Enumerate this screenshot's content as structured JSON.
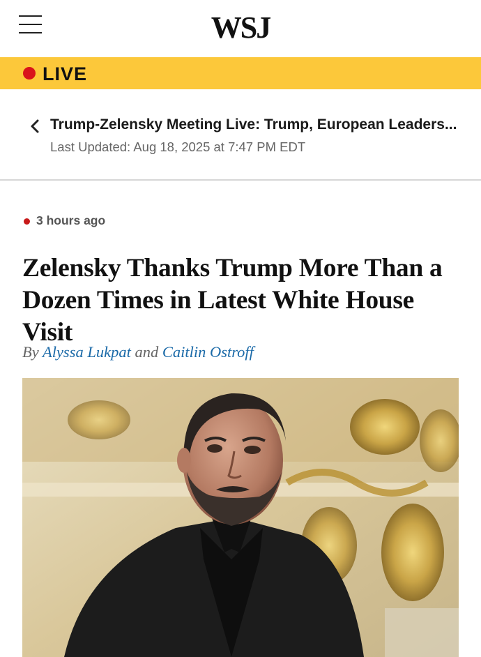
{
  "header": {
    "menu_icon": "hamburger-menu-icon",
    "logo_text": "WSJ"
  },
  "live_bar": {
    "label": "LIVE",
    "dot_color": "#d9141b",
    "background": "#fcc83a"
  },
  "story_nav": {
    "back_icon": "chevron-left-icon",
    "title": "Trump-Zelensky Meeting Live: Trump, European Leaders...",
    "last_updated": "Last Updated: Aug 18, 2025 at 7:47 PM EDT"
  },
  "article": {
    "time_ago": "3 hours ago",
    "headline": "Zelensky Thanks Trump More Than a Dozen Times in Latest White House Visit",
    "byline": {
      "prefix": "By",
      "author1": "Alyssa Lukpat",
      "conjunction": "and",
      "author2": "Caitlin Ostroff"
    },
    "link_color": "#1b6aa8",
    "photo_subject": "portrait photo of man in black shirt against gilded background"
  }
}
